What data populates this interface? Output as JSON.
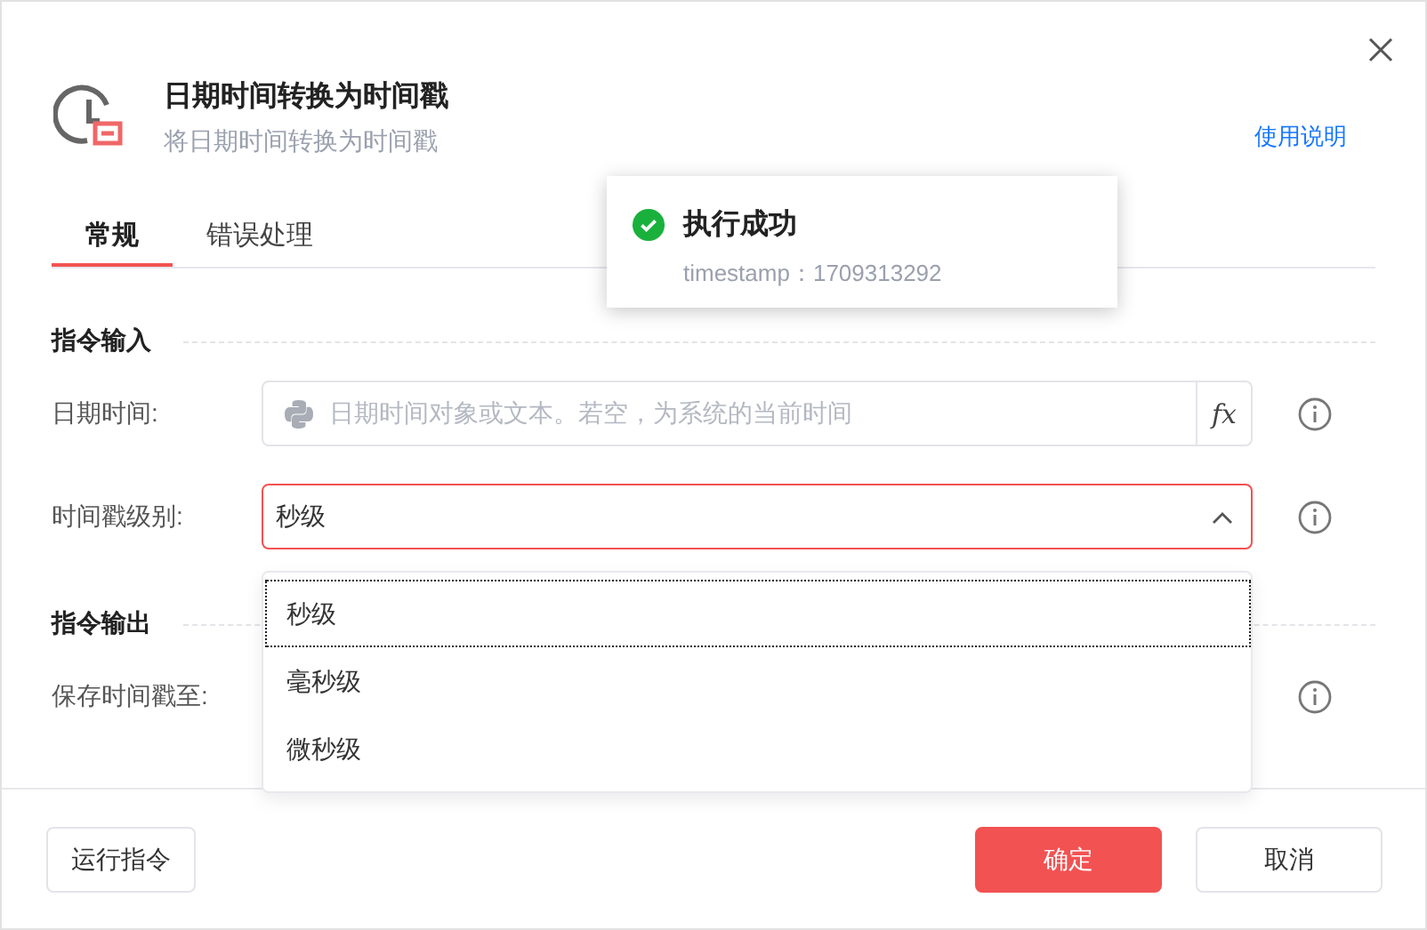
{
  "dialog": {
    "title": "日期时间转换为时间戳",
    "subtitle": "将日期时间转换为时间戳",
    "help_link": "使用说明"
  },
  "tabs": [
    {
      "label": "常规",
      "selected": true
    },
    {
      "label": "错误处理",
      "selected": false
    }
  ],
  "sections": [
    {
      "title": "指令输入",
      "fields": [
        {
          "kind": "text",
          "label": "日期时间:",
          "placeholder": "日期时间对象或文本。若空，为系统的当前时间",
          "fx_label": "fx"
        },
        {
          "kind": "select",
          "label": "时间戳级别:",
          "value": "秒级",
          "error": true,
          "expanded": true,
          "options": [
            {
              "label": "秒级",
              "selected": true
            },
            {
              "label": "毫秒级",
              "selected": false
            },
            {
              "label": "微秒级",
              "selected": false
            }
          ]
        }
      ]
    },
    {
      "title": "指令输出",
      "fields": [
        {
          "kind": "output",
          "label": "保存时间戳至:"
        }
      ]
    }
  ],
  "toast": {
    "title": "执行成功",
    "message": "timestamp：1709313292"
  },
  "buttons": [
    {
      "label": "运行指令",
      "kind": "default"
    },
    {
      "label": "确定",
      "kind": "primary"
    },
    {
      "label": "取消",
      "kind": "default"
    }
  ]
}
